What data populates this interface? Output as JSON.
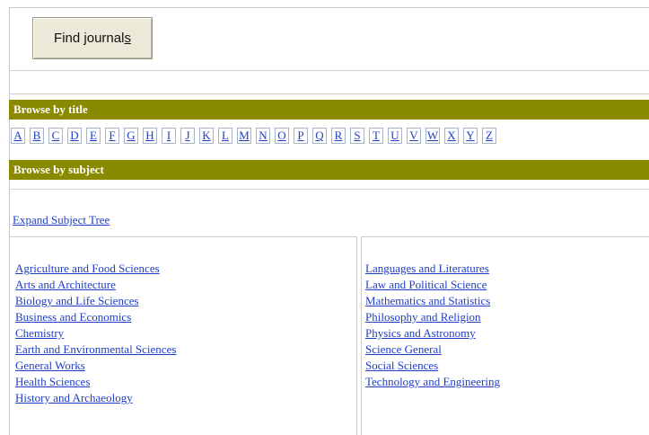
{
  "find_button": {
    "label_pre": "Find journal",
    "label_underlined": "s"
  },
  "browse_by_title": {
    "heading": "Browse by title",
    "letters": [
      "A",
      "B",
      "C",
      "D",
      "E",
      "F",
      "G",
      "H",
      "I",
      "J",
      "K",
      "L",
      "M",
      "N",
      "O",
      "P",
      "Q",
      "R",
      "S",
      "T",
      "U",
      "V",
      "W",
      "X",
      "Y",
      "Z"
    ]
  },
  "browse_by_subject": {
    "heading": "Browse by subject",
    "expand_link": "Expand Subject Tree",
    "left_subjects": [
      "Agriculture and Food Sciences",
      "Arts and Architecture",
      "Biology and Life Sciences",
      "Business and Economics",
      "Chemistry",
      "Earth and Environmental Sciences",
      "General Works",
      "Health Sciences",
      "History and Archaeology"
    ],
    "right_subjects": [
      "Languages and Literatures",
      "Law and Political Science",
      "Mathematics and Statistics",
      "Philosophy and Religion",
      "Physics and Astronomy",
      "Science General",
      "Social Sciences",
      "Technology and Engineering"
    ]
  },
  "colors": {
    "bar": "#8a8a00",
    "link": "#1f3ec7"
  }
}
